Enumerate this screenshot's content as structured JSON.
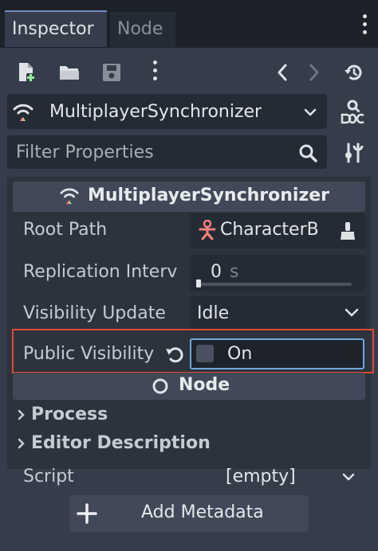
{
  "tabs": [
    {
      "label": "Inspector",
      "active": true
    },
    {
      "label": "Node",
      "active": false
    }
  ],
  "toolbar": {
    "icons": [
      "new-resource-icon",
      "open-folder-icon",
      "save-icon",
      "kebab-menu-icon",
      "history-back-icon",
      "history-forward-icon",
      "object-history-icon"
    ]
  },
  "node_selector": {
    "label": "MultiplayerSynchronizer",
    "icon": "multiplayer-synchronizer-icon"
  },
  "filter": {
    "placeholder": "Filter Properties"
  },
  "section": {
    "title": "MultiplayerSynchronizer",
    "properties": [
      {
        "label": "Root Path",
        "value": "CharacterB"
      },
      {
        "label": "Replication Interv",
        "value": "0",
        "unit": "s",
        "slider_fraction": 0
      },
      {
        "label": "Visibility Update",
        "value": "Idle"
      },
      {
        "label": "Public Visibility",
        "value": "On",
        "checked": false
      }
    ]
  },
  "node_section": {
    "title": "Node",
    "categories": [
      "Process",
      "Editor Description"
    ],
    "script": {
      "label": "Script",
      "value": "[empty]"
    }
  },
  "add_metadata": {
    "label": "Add Metadata"
  },
  "colors": {
    "background": "#1d2229",
    "panel": "#363d4a",
    "field": "#252b34",
    "header": "#414958",
    "highlight": "#e0492f",
    "focus": "#6fa7dc",
    "accent_red": "#fc7f7f"
  }
}
